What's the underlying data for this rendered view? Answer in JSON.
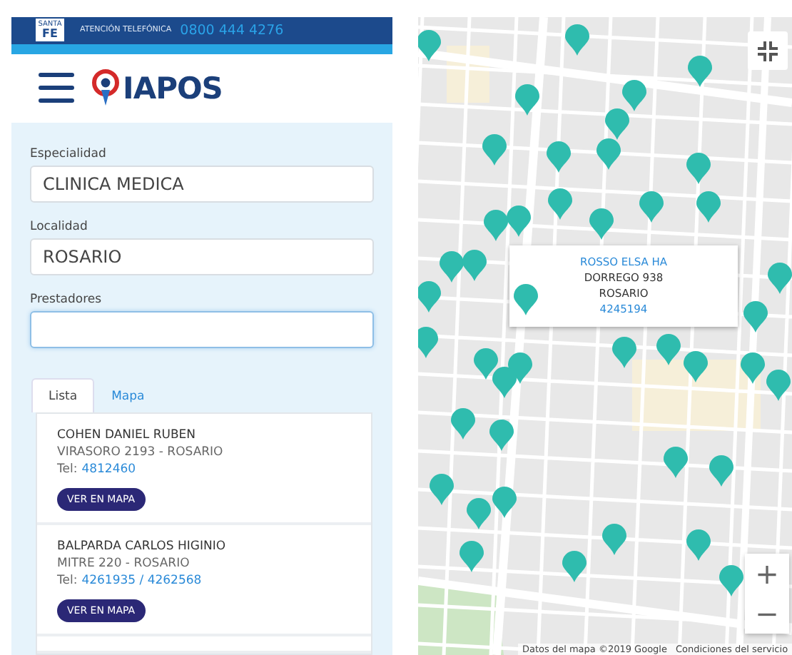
{
  "top_bar": {
    "badge_top": "SANTA",
    "badge_main": "FE",
    "label": "ATENCIÓN TELEFÓNICA",
    "phone": "0800 444 4276"
  },
  "header": {
    "logo_text": "IAPOS"
  },
  "fields": [
    {
      "label": "Especialidad",
      "value": "CLINICA MEDICA",
      "focused": false
    },
    {
      "label": "Localidad",
      "value": "ROSARIO",
      "focused": false
    },
    {
      "label": "Prestadores",
      "focused": true
    }
  ],
  "tabs": [
    {
      "label": "Lista",
      "selected": true
    },
    {
      "label": "Mapa",
      "selected": false
    }
  ],
  "providers": [
    {
      "name": "COHEN DANIEL RUBEN",
      "address": "VIRASORO 2193 - ROSARIO",
      "tel_label": "Tel:",
      "phones": "4812460",
      "button": "VER EN MAPA"
    },
    {
      "name": "BALPARDA CARLOS HIGINIO",
      "address": "MITRE 220 - ROSARIO",
      "tel_label": "Tel:",
      "phones": "4261935 / 4262568",
      "button": "VER EN MAPA"
    }
  ],
  "map": {
    "popup": {
      "name": "ROSSO ELSA HA",
      "address": "DORREGO 938",
      "city": "ROSARIO",
      "phone": "4245194"
    },
    "zoom_in": "+",
    "zoom_out": "−",
    "attribution": [
      "Datos del mapa ©2019 Google",
      "Condiciones del servicio"
    ]
  }
}
